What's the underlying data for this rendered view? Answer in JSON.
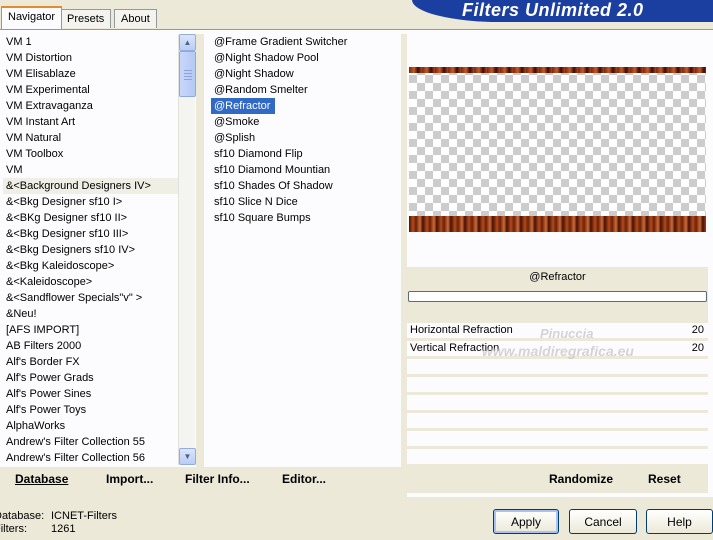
{
  "app_title": "Filters Unlimited 2.0",
  "tabs": [
    {
      "label": "Navigator",
      "active": true
    },
    {
      "label": "Presets",
      "active": false
    },
    {
      "label": "About",
      "active": false
    }
  ],
  "categories": [
    "VM 1",
    "VM Distortion",
    "VM Elisablaze",
    "VM Experimental",
    "VM Extravaganza",
    "VM Instant Art",
    "VM Natural",
    "VM Toolbox",
    "VM",
    "&<Background Designers IV>",
    "&<Bkg Designer sf10 I>",
    "&<BKg Designer sf10 II>",
    "&<Bkg Designer sf10 III>",
    "&<Bkg Designers sf10 IV>",
    "&<Bkg Kaleidoscope>",
    "&<Kaleidoscope>",
    "&<Sandflower Specials\"v\" >",
    "&Neu!",
    "[AFS IMPORT]",
    "AB Filters 2000",
    "Alf's Border FX",
    "Alf's Power Grads",
    "Alf's Power Sines",
    "Alf's Power Toys",
    "AlphaWorks",
    "Andrew's Filter Collection 55",
    "Andrew's Filter Collection 56"
  ],
  "selected_category": "&<Background Designers IV>",
  "filters": [
    "@Frame Gradient Switcher",
    "@Night Shadow Pool",
    "@Night Shadow",
    "@Random Smelter",
    "@Refractor",
    "@Smoke",
    "@Splish",
    "sf10 Diamond Flip",
    "sf10 Diamond Mountian",
    "sf10 Shades Of Shadow",
    "sf10 Slice N Dice",
    "sf10 Square Bumps"
  ],
  "selected_filter": "@Refractor",
  "filter_name": "@Refractor",
  "params": [
    {
      "label": "Horizontal Refraction",
      "value": "20"
    },
    {
      "label": "Vertical Refraction",
      "value": "20"
    }
  ],
  "toolbar": {
    "database": "Database",
    "import": "Import...",
    "filter_info": "Filter Info...",
    "editor": "Editor...",
    "randomize": "Randomize",
    "reset": "Reset"
  },
  "status": {
    "database_label": "Database:",
    "database_value": "ICNET-Filters",
    "filters_label": "Filters:",
    "filters_value": "1261"
  },
  "buttons": {
    "apply": "Apply",
    "cancel": "Cancel",
    "help": "Help"
  },
  "watermark": {
    "line1": "Pinuccia",
    "line2": "www.maldiregrafica.eu"
  }
}
